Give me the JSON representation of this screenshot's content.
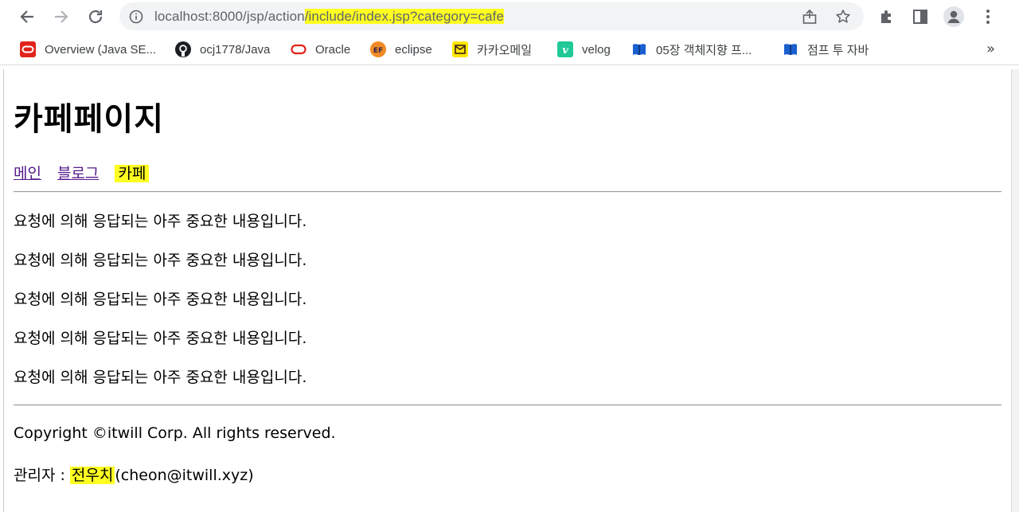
{
  "browser": {
    "url_plain": "localhost:8000/jsp/action",
    "url_highlighted": "/include/index.jsp?category=cafe",
    "highlight_color": "#ffff22",
    "link_color": "#551a8b"
  },
  "bookmarks": {
    "items": [
      {
        "label": "Overview (Java SE...",
        "icon": "oracle-icon"
      },
      {
        "label": "ocj1778/Java",
        "icon": "github-icon"
      },
      {
        "label": "Oracle",
        "icon": "oracle-ring-icon"
      },
      {
        "label": "eclipse",
        "icon": "eclipse-icon"
      },
      {
        "label": "카카오메일",
        "icon": "kakao-mail-icon"
      },
      {
        "label": "velog",
        "icon": "velog-icon"
      },
      {
        "label": "05장 객체지향 프...",
        "icon": "book-icon"
      },
      {
        "label": "점프 투 자바",
        "icon": "book-icon"
      }
    ],
    "more": "»"
  },
  "page": {
    "title": "카페페이지",
    "nav": [
      {
        "label": "메인"
      },
      {
        "label": "블로그"
      },
      {
        "label": "카페"
      }
    ],
    "content_lines": [
      "요청에 의해 응답되는 아주 중요한 내용입니다.",
      "요청에 의해 응답되는 아주 중요한 내용입니다.",
      "요청에 의해 응답되는 아주 중요한 내용입니다.",
      "요청에 의해 응답되는 아주 중요한 내용입니다.",
      "요청에 의해 응답되는 아주 중요한 내용입니다."
    ],
    "footer": {
      "copyright": "Copyright ©itwill Corp. All rights reserved.",
      "admin_label": "관리자 : ",
      "admin_name": "전우치",
      "admin_email": "(cheon@itwill.xyz)"
    }
  }
}
